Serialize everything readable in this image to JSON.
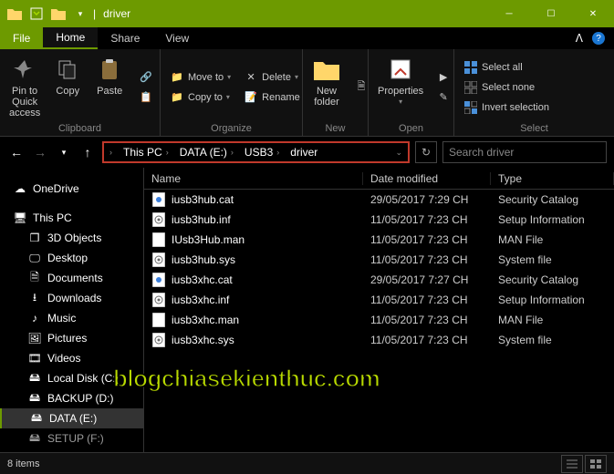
{
  "window": {
    "title": "driver"
  },
  "tabs": {
    "file": "File",
    "home": "Home",
    "share": "Share",
    "view": "View"
  },
  "ribbon": {
    "pin": "Pin to Quick\naccess",
    "copy": "Copy",
    "paste": "Paste",
    "clipboard_label": "Clipboard",
    "moveto": "Move to",
    "copyto": "Copy to",
    "delete": "Delete",
    "rename": "Rename",
    "organize_label": "Organize",
    "newfolder": "New\nfolder",
    "new_label": "New",
    "properties": "Properties",
    "open_label": "Open",
    "selectall": "Select all",
    "selectnone": "Select none",
    "invertsel": "Invert selection",
    "select_label": "Select"
  },
  "breadcrumb": [
    "This PC",
    "DATA (E:)",
    "USB3",
    "driver"
  ],
  "search_placeholder": "Search driver",
  "tree": {
    "onedrive": "OneDrive",
    "thispc": "This PC",
    "objects3d": "3D Objects",
    "desktop": "Desktop",
    "documents": "Documents",
    "downloads": "Downloads",
    "music": "Music",
    "pictures": "Pictures",
    "videos": "Videos",
    "localc": "Local Disk (C:)",
    "backupd": "BACKUP (D:)",
    "datae": "DATA (E:)",
    "setupf": "SETUP (F:)"
  },
  "columns": {
    "name": "Name",
    "date": "Date modified",
    "type": "Type"
  },
  "files": [
    {
      "name": "iusb3hub.cat",
      "date": "29/05/2017 7:29 CH",
      "type": "Security Catalog",
      "icon": "cat"
    },
    {
      "name": "iusb3hub.inf",
      "date": "11/05/2017 7:23 CH",
      "type": "Setup Information",
      "icon": "inf"
    },
    {
      "name": "IUsb3Hub.man",
      "date": "11/05/2017 7:23 CH",
      "type": "MAN File",
      "icon": "man"
    },
    {
      "name": "iusb3hub.sys",
      "date": "11/05/2017 7:23 CH",
      "type": "System file",
      "icon": "sys"
    },
    {
      "name": "iusb3xhc.cat",
      "date": "29/05/2017 7:27 CH",
      "type": "Security Catalog",
      "icon": "cat"
    },
    {
      "name": "iusb3xhc.inf",
      "date": "11/05/2017 7:23 CH",
      "type": "Setup Information",
      "icon": "inf"
    },
    {
      "name": "iusb3xhc.man",
      "date": "11/05/2017 7:23 CH",
      "type": "MAN File",
      "icon": "man"
    },
    {
      "name": "iusb3xhc.sys",
      "date": "11/05/2017 7:23 CH",
      "type": "System file",
      "icon": "sys"
    }
  ],
  "status": "8 items",
  "watermark": "blogchiasekienthuc.com"
}
